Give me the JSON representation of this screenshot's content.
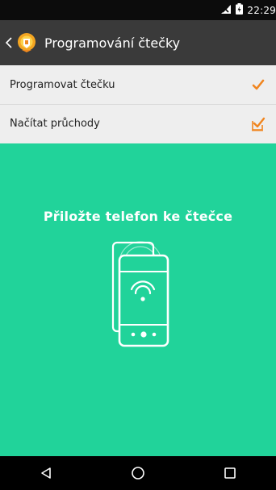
{
  "status_bar": {
    "time": "22:29",
    "icons": [
      "no-sim-icon",
      "battery-icon"
    ]
  },
  "app_bar": {
    "title": "Programování čtečky",
    "icons": [
      "back-chevron-icon",
      "app-logo-icon"
    ]
  },
  "menu": {
    "items": [
      {
        "label": "Programovat čtečku",
        "icon": "checkmark-icon",
        "active": true
      },
      {
        "label": "Načítat průchody",
        "icon": "checkbox-check-icon",
        "active": false
      }
    ]
  },
  "main": {
    "prompt": "Přiložte telefon ke čtečce",
    "illustration": "phone-nfc-icon"
  },
  "nav_bar": {
    "icons": [
      "back-triangle-icon",
      "home-circle-icon",
      "recents-square-icon"
    ]
  },
  "colors": {
    "accent": "#f0851f",
    "panel": "#21d39a",
    "app_bar": "#3a3a3a",
    "list_bg": "#eeeeee"
  }
}
